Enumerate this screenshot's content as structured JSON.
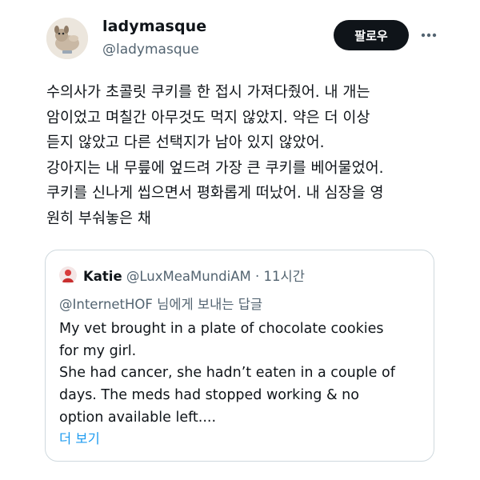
{
  "author": {
    "display_name": "ladymasque",
    "handle": "@ladymasque",
    "avatar_icon": "dog-photo-avatar"
  },
  "actions": {
    "follow_label": "팔로우",
    "more_icon": "more-dots-icon"
  },
  "tweet": {
    "lines": [
      "수의사가 초콜릿 쿠키를 한 접시 가져다줬어. 내 개는",
      "암이었고 며칠간 아무것도 먹지 않았지. 약은 더 이상",
      "듣지 않았고 다른 선택지가 남아 있지 않았어.",
      "강아지는 내 무릎에 엎드려 가장 큰 쿠키를 베어물었어.",
      "쿠키를 신나게 씹으면서 평화롭게 떠났어. 내 심장을 영",
      "원히 부숴놓은 채"
    ]
  },
  "quote": {
    "avatar_icon": "red-avatar",
    "author_name": "Katie",
    "author_handle": "@LuxMeaMundiAM",
    "separator": "·",
    "time": "11시간",
    "reply_mention": "@InternetHOF",
    "reply_suffix": " 님에게 보내는 답글",
    "lines": [
      "My vet brought in a plate of chocolate cookies",
      "for my girl.",
      "She had cancer, she hadn’t eaten in a couple of",
      "days. The meds had stopped working & no",
      "option available left...."
    ],
    "show_more_label": "더 보기"
  },
  "colors": {
    "text": "#0f1419",
    "secondary": "#536471",
    "link": "#1d9bf0",
    "border": "#cfd9de",
    "button_bg": "#0f1419"
  }
}
